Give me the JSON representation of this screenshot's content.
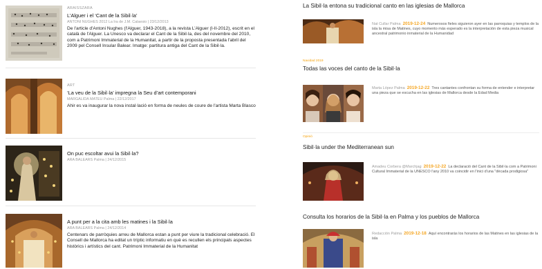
{
  "left_articles": [
    {
      "kicker": "ARAISSZARA",
      "title": "L’Alguer i el ‘Cant de la Sibil·la’",
      "meta": "ANTONI NUGHES 2012 La Ira de J.M. Calaesio | 23/12/2013",
      "text": "De l'article d'Antoni Nughes (l'Alguer, 1943-2018), a la revista L’Alguer (I-II-2012), escrit en el català de l'Alguer. La Unesco va declarar el Cant de la Sibil·la, des del novembre del 2010, com a Patrimoni Immaterial de la Humanitat, a partir de la proposta presentada l'abril del 2009 pel Consell Insular Balear. Imatge: partitura antiga del Cant de la Sibil·la."
    },
    {
      "kicker": "ART",
      "title": "‘La veu de la Sibil·la’ impregna la Seu d’art contemporani",
      "meta": "MARGALIDA MATEU Palma | 22/12/2017",
      "text": "Ahir es va inaugurar la nova instal·lació en forma de neules de coure de l'artista Marta Blasco"
    },
    {
      "kicker": "",
      "title": "On puc escoltar avui la Sibil·la?",
      "meta": "ARA BALEARS Palma | 24/12/2015",
      "text": ""
    },
    {
      "kicker": "",
      "title": "A punt per a la cita amb les matines i la Sibil·la",
      "meta": "ARA BALEARS Palma | 24/12/2014",
      "text": "Centenars de parròquies arreu de Mallorca estan a punt per viure la tradicional celebració. El Consell de Mallorca ha editat un tríptic informatiu en què es recullen els principals aspectes històrics i artístics del cant. Patrimoni Immaterial de la Humanitat"
    }
  ],
  "right_articles": [
    {
      "tag": "",
      "title": "La Sibil·la entona su tradicional canto en las iglesias de Mallorca",
      "author": "Nat Cullar Palma",
      "date": "2019-12-24",
      "text": "Numerosos fieles siguieron ayer en las parroquias y templos de la isla la misa de Matines, cuyo momento más esperado es la interpretación de esta pieza musical ancestral patrimonio inmaterial de la Humanidad"
    },
    {
      "tag": "Navidad 2019",
      "title": "Todas las voces del canto de la Sibil·la",
      "author": "Marta López Palma",
      "date": "2019-12-22",
      "text": "Tres cantantes confrontan su forma de entender e interpretar una pieza que se escucha en las iglesias de Mallorca desde la Edad Media"
    },
    {
      "tag": "Opinió",
      "title": "Sibil·la under the Mediterranean sun",
      "author": "Amadeu Corbera @Marchjag",
      "date": "2019-12-22",
      "text": "La declaració del Cant de la Sibil·la com a Patrimoni Cultural Immaterial de la UNESCO l'any 2010 va coincidir en l'inici d'una \"dècada prodigiosa\""
    },
    {
      "tag": "",
      "title": "Consulta los horarios de la Sibil·la en Palma y los pueblos de Mallorca",
      "author": "Redacción Palma",
      "date": "2019-12-18",
      "text": "Aquí encontraràs los horarios de las Matines en las iglesias de la isla"
    }
  ],
  "colors": {
    "accent": "#f5a623",
    "meta_gray": "#9a9a9a"
  }
}
